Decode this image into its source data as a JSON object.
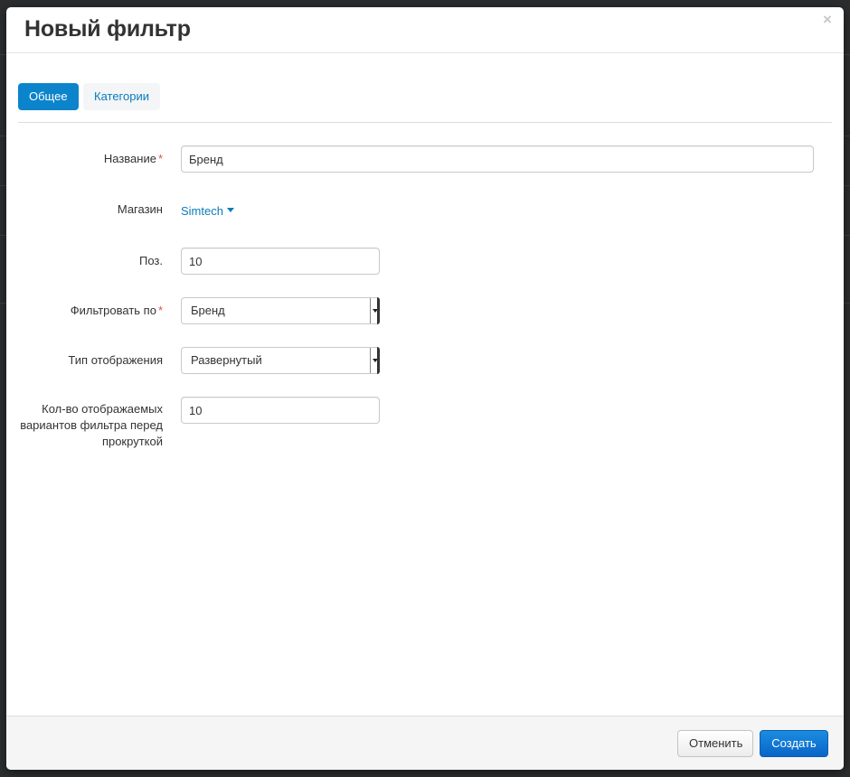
{
  "modal": {
    "title": "Новый фильтр",
    "close_symbol": "×"
  },
  "tabs": [
    {
      "label": "Общее",
      "active": true
    },
    {
      "label": "Категории",
      "active": false
    }
  ],
  "form": {
    "name": {
      "label": "Название",
      "required_mark": "*",
      "value": "Бренд"
    },
    "storefront": {
      "label": "Магазин",
      "value": "Simtech"
    },
    "position": {
      "label": "Поз.",
      "value": "10"
    },
    "filter_by": {
      "label": "Фильтровать по",
      "required_mark": "*",
      "selected": "Бренд"
    },
    "display_type": {
      "label": "Тип отображения",
      "selected": "Развернутый"
    },
    "display_count": {
      "label_lines": [
        "Кол-во отображаемых",
        "вариантов фильтра перед",
        "прокруткой"
      ],
      "value": "10"
    }
  },
  "footer": {
    "cancel_label": "Отменить",
    "create_label": "Создать"
  },
  "colors": {
    "accent": "#0b84cb",
    "primary_button": "#0a65c7",
    "required": "#d9534f",
    "link": "#0b7bbd"
  },
  "icons": {
    "close": "close-icon",
    "storefront_caret": "caret-down-icon",
    "select_arrow": "chevron-down-icon"
  }
}
